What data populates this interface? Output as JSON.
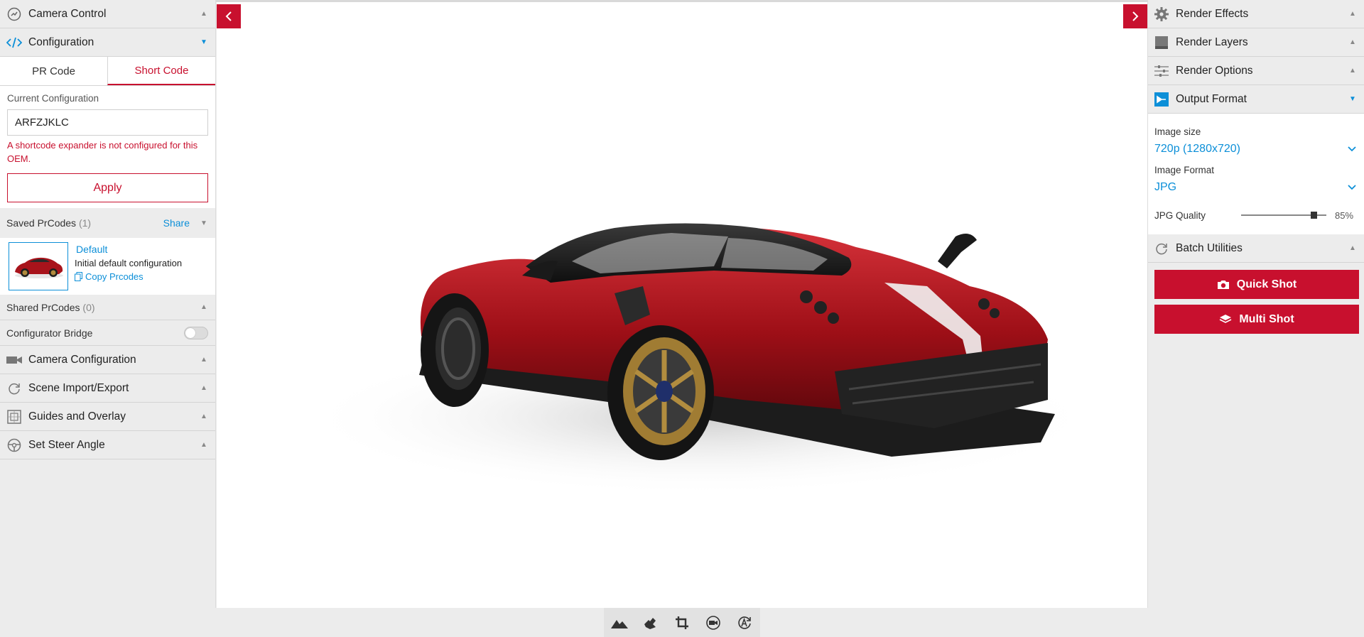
{
  "left_panel": {
    "camera_control": "Camera Control",
    "configuration": "Configuration",
    "tabs": {
      "pr_code": "PR Code",
      "short_code": "Short Code"
    },
    "current_config_label": "Current Configuration",
    "current_config_value": "ARFZJKLC",
    "error_text": "A shortcode expander is not configured for this OEM.",
    "apply_label": "Apply",
    "saved_prcodes": {
      "label": "Saved PrCodes",
      "count": "(1)",
      "share": "Share"
    },
    "prcode_item": {
      "name": "Default",
      "description": "Initial default configuration",
      "copy_label": "Copy Prcodes"
    },
    "shared_prcodes": {
      "label": "Shared PrCodes",
      "count": "(0)"
    },
    "configurator_bridge": "Configurator Bridge",
    "sections": [
      "Camera Configuration",
      "Scene Import/Export",
      "Guides and Overlay",
      "Set Steer Angle"
    ]
  },
  "right_panel": {
    "render_effects": "Render Effects",
    "render_layers": "Render Layers",
    "render_options": "Render Options",
    "output_format": "Output Format",
    "image_size_label": "Image size",
    "image_size_value": "720p (1280x720)",
    "image_format_label": "Image Format",
    "image_format_value": "JPG",
    "jpg_quality_label": "JPG Quality",
    "jpg_quality_value": "85%",
    "jpg_quality_fraction": 0.85,
    "batch_utilities": "Batch Utilities",
    "quick_shot": "Quick Shot",
    "multi_shot": "Multi Shot"
  },
  "colors": {
    "accent": "#c8102e",
    "link": "#0c8fd8"
  },
  "icons": {
    "left": [
      "camera-control-icon",
      "code-icon",
      "camera-icon",
      "refresh-icon",
      "guides-icon",
      "steering-wheel-icon",
      "copy-icon"
    ],
    "right": [
      "gear-icon",
      "layers-icon",
      "sliders-icon",
      "output-icon",
      "refresh-icon",
      "camera-icon",
      "stack-icon"
    ],
    "toolbar": [
      "landscape-icon",
      "hand-rotate-icon",
      "crop-icon",
      "video-camera-icon",
      "auto-rotate-icon"
    ]
  }
}
